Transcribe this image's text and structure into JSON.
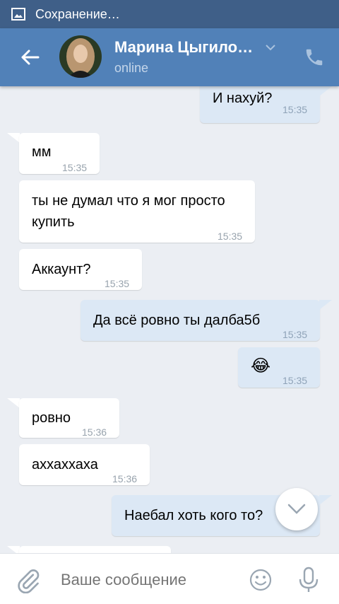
{
  "status_bar": {
    "text": "Сохранение…",
    "icon": "image-icon"
  },
  "header": {
    "name": "Марина Цыгило…",
    "status": "online",
    "back_icon": "arrow-left-icon",
    "dropdown_icon": "chevron-down-icon",
    "call_icon": "phone-icon"
  },
  "messages": [
    {
      "dir": "out",
      "text": "И нахуй?",
      "time": "15:35"
    },
    {
      "dir": "in",
      "text": "мм",
      "time": "15:35"
    },
    {
      "dir": "in",
      "text_lines": [
        "ты не думал что я мог просто",
        "купить"
      ],
      "time": "15:35"
    },
    {
      "dir": "in",
      "text": "Аккаунт?",
      "time": "15:35"
    },
    {
      "dir": "out",
      "text": "Да всё ровно ты далба5б",
      "time": "15:35"
    },
    {
      "dir": "out",
      "emoji": "😂",
      "time": "15:35"
    },
    {
      "dir": "in",
      "text": "ровно",
      "time": "15:36"
    },
    {
      "dir": "in",
      "text": "аххаххаха",
      "time": "15:36"
    },
    {
      "dir": "out",
      "text": "Наебал хоть кого то?"
    }
  ],
  "composer": {
    "placeholder": "Ваше сообщение",
    "attach_icon": "paperclip-icon",
    "emoji_icon": "smile-icon",
    "mic_icon": "microphone-icon"
  },
  "scroll_down_icon": "chevron-down-icon",
  "colors": {
    "header": "#5181b8",
    "status_bar": "#3f5f88",
    "background": "#ebeef3",
    "outgoing_bubble": "#dce8f5",
    "incoming_bubble": "#ffffff"
  }
}
